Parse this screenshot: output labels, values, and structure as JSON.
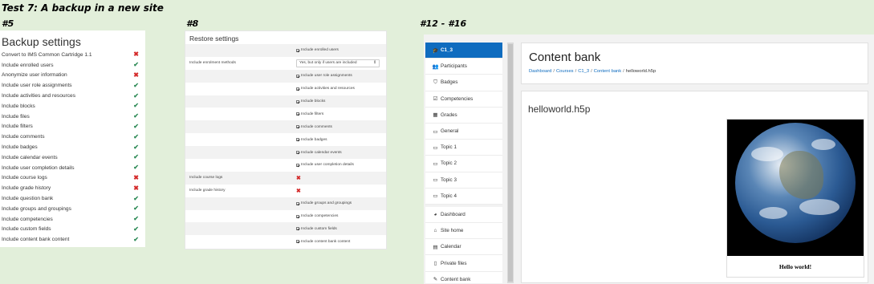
{
  "title": "Test 7: A backup in a new site",
  "labels": {
    "s1": "#5",
    "s2": "#8",
    "s3": "#12 - #16"
  },
  "backup": {
    "heading": "Backup settings",
    "rows": [
      {
        "label": "Convert to IMS Common Cartridge 1.1",
        "mark": "✖",
        "state": "no"
      },
      {
        "label": "Include enrolled users",
        "mark": "✔",
        "state": "yes"
      },
      {
        "label": "Anonymize user information",
        "mark": "✖",
        "state": "no"
      },
      {
        "label": "Include user role assignments",
        "mark": "✔",
        "state": "yes"
      },
      {
        "label": "Include activities and resources",
        "mark": "✔",
        "state": "yes"
      },
      {
        "label": "Include blocks",
        "mark": "✔",
        "state": "yes"
      },
      {
        "label": "Include files",
        "mark": "✔",
        "state": "yes"
      },
      {
        "label": "Include filters",
        "mark": "✔",
        "state": "yes"
      },
      {
        "label": "Include comments",
        "mark": "✔",
        "state": "yes"
      },
      {
        "label": "Include badges",
        "mark": "✔",
        "state": "yes"
      },
      {
        "label": "Include calendar events",
        "mark": "✔",
        "state": "yes"
      },
      {
        "label": "Include user completion details",
        "mark": "✔",
        "state": "yes"
      },
      {
        "label": "Include course logs",
        "mark": "✖",
        "state": "no"
      },
      {
        "label": "Include grade history",
        "mark": "✖",
        "state": "no"
      },
      {
        "label": "Include question bank",
        "mark": "✔",
        "state": "yes"
      },
      {
        "label": "Include groups and groupings",
        "mark": "✔",
        "state": "yes"
      },
      {
        "label": "Include competencies",
        "mark": "✔",
        "state": "yes"
      },
      {
        "label": "Include custom fields",
        "mark": "✔",
        "state": "yes"
      },
      {
        "label": "Include content bank content",
        "mark": "✔",
        "state": "yes"
      }
    ]
  },
  "restore": {
    "heading": "Restore settings",
    "rows": [
      {
        "label": "",
        "kind": "check",
        "value": "Include enrolled users",
        "shaded": true
      },
      {
        "label": "Include enrolment methods",
        "kind": "select",
        "value": "Yes, but only if users are included",
        "shaded": false
      },
      {
        "label": "",
        "kind": "check",
        "value": "Include user role assignments",
        "shaded": true
      },
      {
        "label": "",
        "kind": "check",
        "value": "Include activities and resources",
        "shaded": false
      },
      {
        "label": "",
        "kind": "check",
        "value": "Include blocks",
        "shaded": true
      },
      {
        "label": "",
        "kind": "check",
        "value": "Include filters",
        "shaded": false
      },
      {
        "label": "",
        "kind": "check",
        "value": "Include comments",
        "shaded": true
      },
      {
        "label": "",
        "kind": "check",
        "value": "Include badges",
        "shaded": false
      },
      {
        "label": "",
        "kind": "check",
        "value": "Include calendar events",
        "shaded": true
      },
      {
        "label": "",
        "kind": "check",
        "value": "Include user completion details",
        "shaded": false
      },
      {
        "label": "Include course logs",
        "kind": "x",
        "value": "✖",
        "shaded": true
      },
      {
        "label": "Include grade history",
        "kind": "x",
        "value": "✖",
        "shaded": false
      },
      {
        "label": "",
        "kind": "check",
        "value": "Include groups and groupings",
        "shaded": true
      },
      {
        "label": "",
        "kind": "check",
        "value": "Include competencies",
        "shaded": false
      },
      {
        "label": "",
        "kind": "check",
        "value": "Include custom fields",
        "shaded": true
      },
      {
        "label": "",
        "kind": "check",
        "value": "Include content bank content",
        "shaded": false
      }
    ]
  },
  "moodle": {
    "nav": [
      {
        "label": "C1_3",
        "icon": "graduation-cap-icon",
        "glyph": "🎓",
        "active": true
      },
      {
        "label": "Participants",
        "icon": "users-icon",
        "glyph": "👥",
        "active": false
      },
      {
        "label": "Badges",
        "icon": "shield-icon",
        "glyph": "⛉",
        "active": false
      },
      {
        "label": "Competencies",
        "icon": "check-square-icon",
        "glyph": "☑",
        "active": false
      },
      {
        "label": "Grades",
        "icon": "table-icon",
        "glyph": "▦",
        "active": false
      },
      {
        "label": "General",
        "icon": "folder-icon",
        "glyph": "▭",
        "active": false
      },
      {
        "label": "Topic 1",
        "icon": "folder-icon",
        "glyph": "▭",
        "active": false
      },
      {
        "label": "Topic 2",
        "icon": "folder-icon",
        "glyph": "▭",
        "active": false
      },
      {
        "label": "Topic 3",
        "icon": "folder-icon",
        "glyph": "▭",
        "active": false
      },
      {
        "label": "Topic 4",
        "icon": "folder-icon",
        "glyph": "▭",
        "active": false
      }
    ],
    "nav2": [
      {
        "label": "Dashboard",
        "icon": "dashboard-icon",
        "glyph": "◕"
      },
      {
        "label": "Site home",
        "icon": "home-icon",
        "glyph": "⌂"
      },
      {
        "label": "Calendar",
        "icon": "calendar-icon",
        "glyph": "▤"
      },
      {
        "label": "Private files",
        "icon": "file-icon",
        "glyph": "▯"
      },
      {
        "label": "Content bank",
        "icon": "brush-icon",
        "glyph": "✎"
      }
    ],
    "page_title": "Content bank",
    "breadcrumb": [
      "Dashboard",
      "Courses",
      "C1_3",
      "Content bank",
      "helloworld.h5p"
    ],
    "content_title": "helloworld.h5p",
    "caption": "Hello world!",
    "colors": {
      "accent": "#0f6cbf",
      "check": "#2e8b57",
      "cross": "#d42a2a",
      "background": "#e2efda"
    }
  }
}
